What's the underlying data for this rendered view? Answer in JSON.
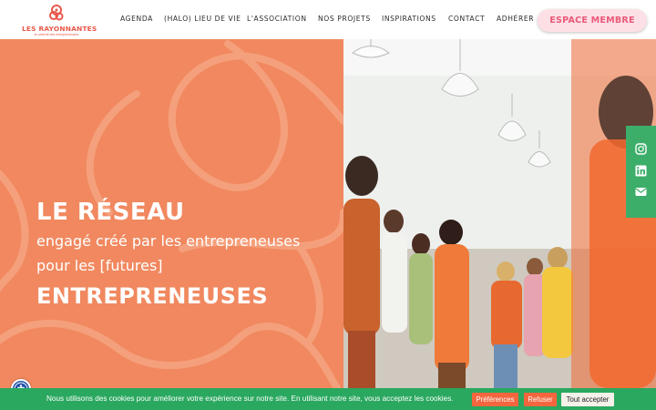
{
  "header": {
    "logo": {
      "name": "LES RAYONNANTES",
      "tagline": "le collectif des entrepreneuses"
    },
    "nav": [
      "AGENDA",
      "(HALO) LIEU DE VIE",
      "L'ASSOCIATION",
      "NOS PROJETS",
      "INSPIRATIONS",
      "CONTACT",
      "ADHÉRER"
    ],
    "member_button": "ESPACE MEMBRE"
  },
  "hero": {
    "title": "LE RÉSEAU",
    "line1": "engagé créé par les entrepreneuses",
    "line2": "pour les [futures]",
    "title2": "ENTREPRENEUSES"
  },
  "social": {
    "icons": [
      "instagram-icon",
      "linkedin-icon",
      "mail-icon"
    ]
  },
  "cookie_bar": {
    "text": "Nous utilisons des cookies pour améliorer votre expérience sur notre site. En utilisant notre site, vous acceptez les cookies.",
    "preferences": "Préférences",
    "refuse": "Refuser",
    "accept": "Tout accepter"
  },
  "colors": {
    "hero_orange": "#f1885f",
    "brand_pink": "#ea5a79",
    "social_green": "#3dae6a",
    "cookie_green": "#2aa85f",
    "cookie_button": "#f5653e"
  }
}
